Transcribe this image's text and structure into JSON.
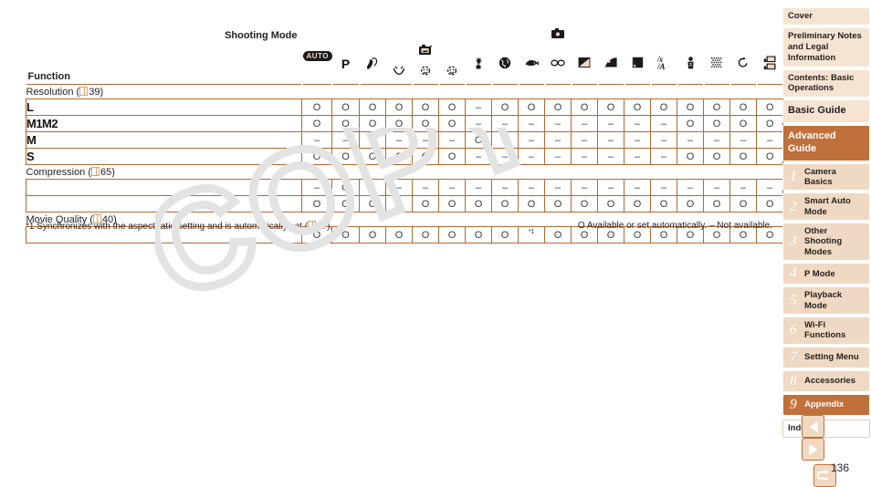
{
  "page": {
    "number": "136",
    "colors": {
      "accent_border": "#b5672e",
      "header_fill": "#f0d9c2",
      "nav_fill": "#f6e4d2",
      "nav_active": "#c0703a",
      "text": "#231f20",
      "link_orange": "#d9a273"
    }
  },
  "table": {
    "corner": {
      "shooting_mode_label": "Shooting Mode",
      "function_label": "Function"
    },
    "top_group_label": "camera-icon",
    "mode_columns": [
      {
        "id": "auto",
        "glyph": "AUTO",
        "type": "badge"
      },
      {
        "id": "p",
        "glyph": "P",
        "type": "letter"
      },
      {
        "id": "portrait",
        "glyph": "portrait-icon",
        "type": "icon"
      },
      {
        "id": "smile",
        "glyph": "smile-icon",
        "type": "icon",
        "group": "smart-shutter"
      },
      {
        "id": "wink-self-timer",
        "glyph": "wink-self-timer-icon",
        "type": "icon",
        "group": "smart-shutter"
      },
      {
        "id": "face-self-timer",
        "glyph": "face-self-timer-icon",
        "type": "icon",
        "group": "smart-shutter"
      },
      {
        "id": "high-speed-burst",
        "glyph": "starburst-icon",
        "type": "icon"
      },
      {
        "id": "handheld-nightscene",
        "glyph": "night-scene-icon",
        "type": "icon"
      },
      {
        "id": "underwater",
        "glyph": "fish-icon",
        "type": "icon"
      },
      {
        "id": "snow",
        "glyph": "glasses-icon",
        "type": "icon"
      },
      {
        "id": "fireworks",
        "glyph": "contrast-icon",
        "type": "icon"
      },
      {
        "id": "fisheye",
        "glyph": "fisheye-icon",
        "type": "icon"
      },
      {
        "id": "miniature",
        "glyph": "miniature-icon",
        "type": "icon"
      },
      {
        "id": "toy-camera",
        "glyph": "toy-camera-icon",
        "type": "icon"
      },
      {
        "id": "monochrome",
        "glyph": "monochrome-icon",
        "type": "icon"
      },
      {
        "id": "super-vivid",
        "glyph": "super-vivid-icon",
        "type": "icon"
      },
      {
        "id": "poster-effect",
        "glyph": "poster-effect-icon",
        "type": "icon"
      },
      {
        "id": "movie",
        "glyph": "movie-icon",
        "type": "icon"
      }
    ],
    "smart_shutter_group_glyph": "smart-shutter-icon",
    "sections": [
      {
        "id": "resolution",
        "label": "Resolution (",
        "page_ref": "39",
        "label_suffix": ")",
        "rows": [
          {
            "id": "L",
            "glyph": "L",
            "values": [
              "O",
              "O",
              "O",
              "O",
              "O",
              "O",
              "–",
              "O",
              "O",
              "O",
              "O",
              "O",
              "O",
              "O",
              "O",
              "O",
              "O",
              "O"
            ]
          },
          {
            "id": "M1M2",
            "glyph": "M1M2",
            "values": [
              "O",
              "O",
              "O",
              "O",
              "O",
              "O",
              "–",
              "–",
              "–",
              "–",
              "–",
              "–",
              "–",
              "–",
              "O",
              "O",
              "O",
              "O"
            ]
          },
          {
            "id": "M",
            "glyph": "M",
            "values": [
              "–",
              "–",
              "–",
              "–",
              "–",
              "–",
              "O",
              "–",
              "–",
              "–",
              "–",
              "–",
              "–",
              "–",
              "–",
              "–",
              "–",
              "–"
            ]
          },
          {
            "id": "S",
            "glyph": "S",
            "values": [
              "O",
              "O",
              "O",
              "O",
              "O",
              "O",
              "–",
              "–",
              "–",
              "–",
              "–",
              "–",
              "–",
              "–",
              "O",
              "O",
              "O",
              "O"
            ]
          }
        ]
      },
      {
        "id": "compression",
        "label": "Compression (",
        "page_ref": "65",
        "label_suffix": ")",
        "rows": [
          {
            "id": "fine",
            "glyph": "compression-fine-icon",
            "values": [
              "–",
              "O",
              "–",
              "–",
              "–",
              "–",
              "–",
              "–",
              "–",
              "–",
              "–",
              "–",
              "–",
              "–",
              "–",
              "–",
              "–",
              "–"
            ]
          },
          {
            "id": "normal",
            "glyph": "compression-normal-icon",
            "values": [
              "O",
              "O",
              "O",
              "O",
              "O",
              "O",
              "O",
              "O",
              "O",
              "O",
              "O",
              "O",
              "O",
              "O",
              "O",
              "O",
              "O",
              "O"
            ]
          }
        ]
      },
      {
        "id": "movie-quality",
        "label": "Movie Quality (",
        "page_ref": "40",
        "label_suffix": ")",
        "rows": [
          {
            "id": "movie-res",
            "glyph": "1280-640-icon",
            "values": [
              "O",
              "O",
              "O",
              "O",
              "O",
              "O",
              "O",
              "O",
              "*1",
              "O",
              "O",
              "O",
              "O",
              "O",
              "O",
              "O",
              "O",
              "O"
            ]
          }
        ]
      }
    ]
  },
  "footnotes": {
    "left_prefix": "*1 Synchronizes with the aspect ratio setting and is automatically set (",
    "left_page_ref": "47",
    "left_suffix": ").",
    "right": "O Available or set automatically. – Not available."
  },
  "sidebar": {
    "items": [
      {
        "id": "cover",
        "label": "Cover",
        "style": "plain",
        "active": false
      },
      {
        "id": "preliminary-notes",
        "label": "Preliminary Notes and Legal Information",
        "style": "plain",
        "active": false
      },
      {
        "id": "contents",
        "label": "Contents: Basic Operations",
        "style": "plain",
        "active": false
      },
      {
        "id": "basic-guide",
        "label": "Basic Guide",
        "style": "big",
        "active": false
      },
      {
        "id": "advanced-guide",
        "label": "Advanced Guide",
        "style": "big",
        "active": true
      }
    ],
    "chapters": [
      {
        "num": "1",
        "label": "Camera Basics",
        "active": false
      },
      {
        "num": "2",
        "label": "Smart Auto Mode",
        "active": false
      },
      {
        "num": "3",
        "label": "Other Shooting Modes",
        "active": false
      },
      {
        "num": "4",
        "label": "P Mode",
        "active": false
      },
      {
        "num": "5",
        "label": "Playback Mode",
        "active": false
      },
      {
        "num": "6",
        "label": "Wi-Fi Functions",
        "active": false
      },
      {
        "num": "7",
        "label": "Setting Menu",
        "active": false
      },
      {
        "num": "8",
        "label": "Accessories",
        "active": false
      },
      {
        "num": "9",
        "label": "Appendix",
        "active": true
      }
    ],
    "index": {
      "id": "index",
      "label": "Index"
    }
  },
  "pagenav": {
    "prev": "previous-page-button",
    "next": "next-page-button",
    "home": "back-button"
  },
  "watermark": {
    "text": "COPY"
  }
}
